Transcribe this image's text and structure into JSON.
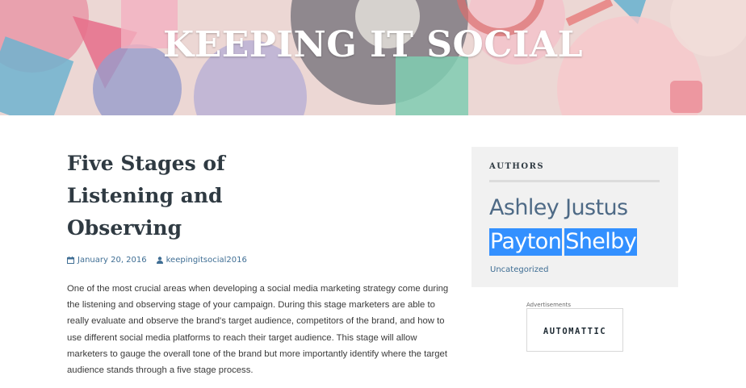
{
  "site": {
    "title": "KEEPING IT SOCIAL"
  },
  "post": {
    "title": "Five Stages of Listening and Observing",
    "date": "January 20, 2016",
    "author": "keepingitsocial2016",
    "excerpt": "One of the most crucial areas when developing a social media marketing strategy come during the listening and observing stage of your campaign. During this stage marketers are able to really evaluate and observe the brand's target audience, competitors of the brand, and how to use different social media platforms to reach their target audience. This stage will allow marketers to gauge the overall tone of the brand but more importantly identify where the target audience stands through a five stage process."
  },
  "sidebar": {
    "widget_title": "AUTHORS",
    "authors": [
      {
        "first": "Ashley",
        "last": "Justus",
        "selected": false
      },
      {
        "first": "Payton",
        "last": "Shelby",
        "selected": true
      }
    ],
    "category_link": "Uncategorized",
    "ad_label": "Advertisements",
    "ad_brand": "AUTOMATTIC"
  },
  "colors": {
    "link": "#3f6e94",
    "heading": "#2f3a42",
    "selection": "#3390ff",
    "widget_bg": "#f1f1f1"
  },
  "icons": [
    "calendar-icon",
    "user-icon"
  ]
}
